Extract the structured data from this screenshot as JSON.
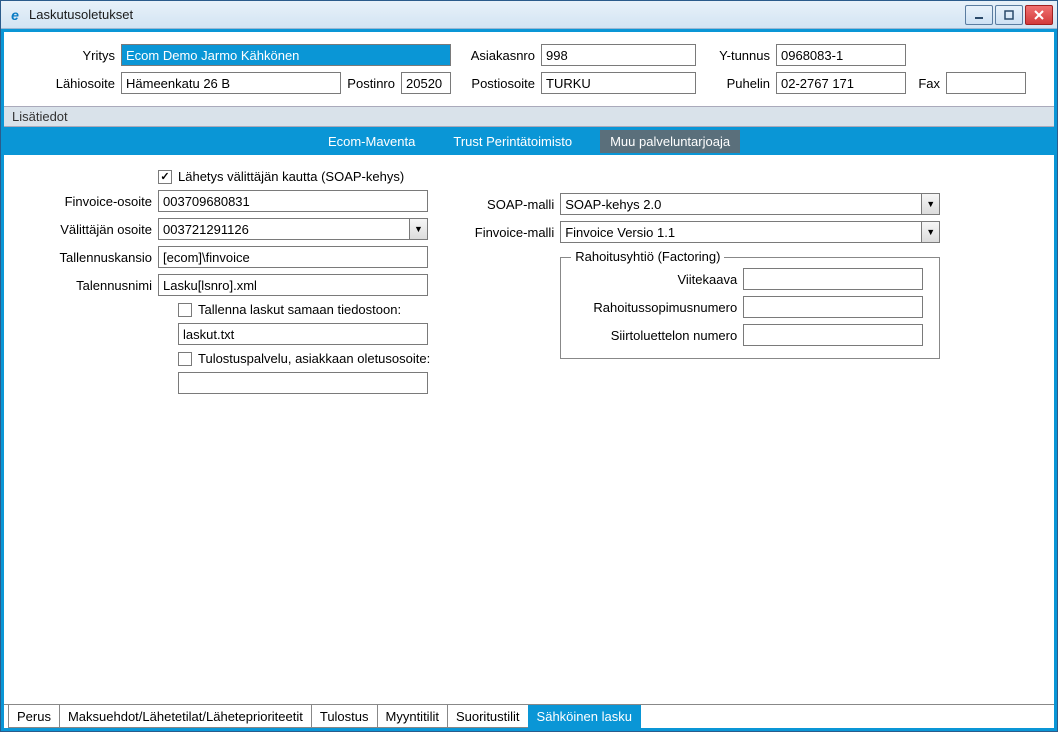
{
  "window": {
    "title": "Laskutusoletukset",
    "app_icon": "e"
  },
  "header": {
    "labels": {
      "yritys": "Yritys",
      "asiakasnro": "Asiakasnro",
      "ytunnus": "Y-tunnus",
      "lahiosoite": "Lähiosoite",
      "postinro": "Postinro",
      "postiosoite": "Postiosoite",
      "puhelin": "Puhelin",
      "fax": "Fax"
    },
    "values": {
      "yritys": "Ecom Demo Jarmo Kähkönen",
      "asiakasnro": "998",
      "ytunnus": "0968083-1",
      "lahiosoite": "Hämeenkatu 26 B",
      "postinro": "20520",
      "postiosoite": "TURKU",
      "puhelin": "02-2767 171",
      "fax": ""
    }
  },
  "section_header": "Lisätiedot",
  "blue_tabs": {
    "items": [
      "Ecom-Maventa",
      "Trust Perintätoimisto",
      "Muu palveluntarjoaja"
    ],
    "active_index": 2
  },
  "form": {
    "left": {
      "lahetys_valittajan_label": "Lähetys välittäjän kautta (SOAP-kehys)",
      "lahetys_valittajan_checked": true,
      "finvoice_osoite_label": "Finvoice-osoite",
      "finvoice_osoite": "003709680831",
      "valittajan_osoite_label": "Välittäjän osoite",
      "valittajan_osoite": "003721291126",
      "tallennuskansio_label": "Tallennuskansio",
      "tallennuskansio": "[ecom]\\finvoice",
      "talennusnimi_label": "Talennusnimi",
      "talennusnimi": "Lasku[lsnro].xml",
      "tallenna_laskut_label": "Tallenna laskut samaan tiedostoon:",
      "tallenna_laskut_checked": false,
      "tallenna_laskut_file": "laskut.txt",
      "tulostuspalvelu_label": "Tulostuspalvelu, asiakkaan oletusosoite:",
      "tulostuspalvelu_checked": false,
      "tulostuspalvelu_value": ""
    },
    "right": {
      "soap_malli_label": "SOAP-malli",
      "soap_malli": "SOAP-kehys 2.0",
      "finvoice_malli_label": "Finvoice-malli",
      "finvoice_malli": "Finvoice Versio 1.1",
      "fieldset_legend": "Rahoitusyhtiö (Factoring)",
      "viitekaava_label": "Viitekaava",
      "viitekaava": "",
      "rahoitussopimusnumero_label": "Rahoitussopimusnumero",
      "rahoitussopimusnumero": "",
      "siirtoluettelon_label": "Siirtoluettelon numero",
      "siirtoluettelon": ""
    }
  },
  "bottom_tabs": {
    "items": [
      "Perus",
      "Maksuehdot/Lähetetilat/Läheteprioriteetit",
      "Tulostus",
      "Myyntitilit",
      "Suoritustilit",
      "Sähköinen lasku"
    ],
    "active_index": 5
  }
}
